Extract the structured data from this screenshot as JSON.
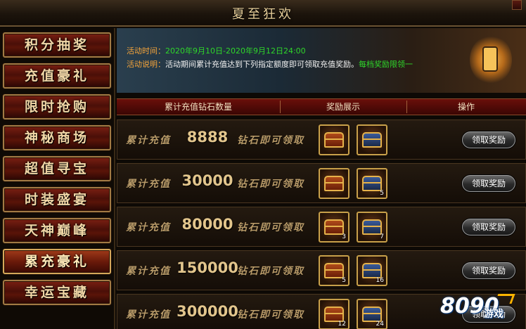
{
  "window": {
    "title": "夏至狂欢"
  },
  "sidebar": {
    "items": [
      {
        "label": "积分抽奖",
        "active": false
      },
      {
        "label": "充值豪礼",
        "active": false
      },
      {
        "label": "限时抢购",
        "active": false
      },
      {
        "label": "神秘商场",
        "active": false
      },
      {
        "label": "超值寻宝",
        "active": false
      },
      {
        "label": "时装盛宴",
        "active": false
      },
      {
        "label": "天神巅峰",
        "active": false
      },
      {
        "label": "累充豪礼",
        "active": true
      },
      {
        "label": "幸运宝藏",
        "active": false
      }
    ]
  },
  "banner": {
    "time_label": "活动时间：",
    "time_value": "2020年9月10日-2020年9月12日24:00",
    "desc_label": "活动说明：",
    "desc_text": "活动期间累计充值达到下列指定额度即可领取充值奖励。",
    "desc_note": "每档奖励限领一"
  },
  "table": {
    "headers": [
      "累计充值钻石数量",
      "奖励展示",
      "操作"
    ],
    "rows": [
      {
        "lead": "累计充值",
        "amount": "8888",
        "tail": "钻石即可领取",
        "item1_qty": "",
        "item2_qty": "",
        "button": "领取奖励"
      },
      {
        "lead": "累计充值",
        "amount": "30000",
        "tail": "钻石即可领取",
        "item1_qty": "",
        "item2_qty": "5",
        "button": "领取奖励"
      },
      {
        "lead": "累计充值",
        "amount": "80000",
        "tail": "钻石即可领取",
        "item1_qty": "3",
        "item2_qty": "7",
        "button": "领取奖励"
      },
      {
        "lead": "累计充值",
        "amount": "150000",
        "tail": "钻石即可领取",
        "item1_qty": "5",
        "item2_qty": "16",
        "button": "领取奖励"
      },
      {
        "lead": "累计充值",
        "amount": "300000",
        "tail": "钻石即可领取",
        "item1_qty": "12",
        "item2_qty": "24",
        "button": "领取奖励"
      }
    ]
  },
  "watermark": {
    "number": "8090",
    "text": "游戏"
  },
  "colors": {
    "label_orange": "#f5a43a",
    "date_green": "#2fd62a",
    "header_red": "#6a0f0a",
    "gold": "#c8a04a"
  },
  "icons": [
    "close-icon",
    "treasure-chest-icon"
  ]
}
